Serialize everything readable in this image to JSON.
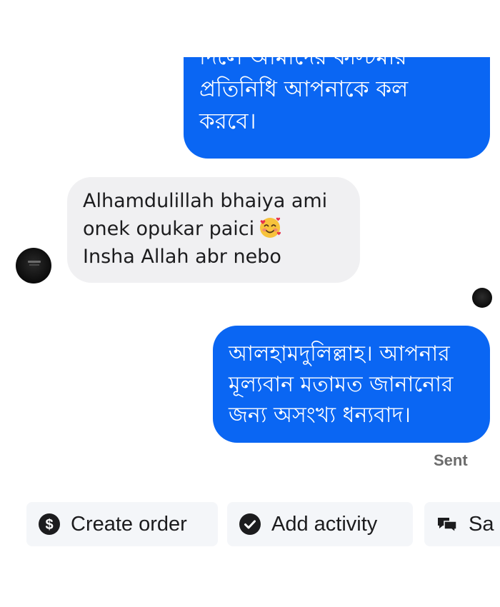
{
  "messages": {
    "outgoing_top": {
      "lines": [
        "দিলে আমাদের কাস্টমার",
        "প্রতিনিধি আপনাকে কল",
        "করবে।"
      ]
    },
    "incoming": {
      "lines": [
        "Alhamdulillah bhaiya ami",
        "onek opukar paici",
        "Insha Allah abr nebo"
      ],
      "emoji": "smiling-face-with-hearts"
    },
    "outgoing_bottom": {
      "lines": [
        "আলহামদুলিল্লাহ। আপনার",
        "মূল্যবান মতামত জানানোর",
        "জন্য অসংখ্য ধন্যবাদ।"
      ]
    },
    "status": "Sent"
  },
  "actions": [
    {
      "label": "Create order",
      "icon": "dollar-icon"
    },
    {
      "label": "Add activity",
      "icon": "check-circle-icon"
    },
    {
      "label": "Sa",
      "icon": "saved-replies-icon"
    }
  ],
  "colors": {
    "outgoing_bubble": "#0a66f3",
    "incoming_bubble": "#f0f0f2",
    "chip_background": "#f4f6f9"
  }
}
